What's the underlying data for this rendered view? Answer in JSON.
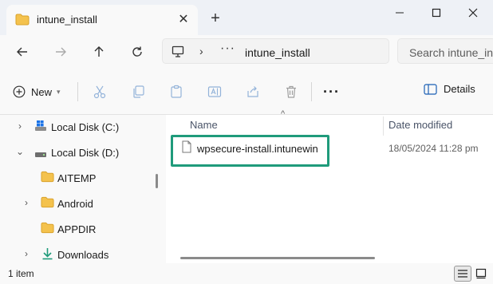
{
  "window": {
    "tab_title": "intune_install",
    "new_tab_glyph": "+",
    "close_tab_glyph": "✕"
  },
  "address": {
    "breadcrumb_overflow": "···",
    "path": "intune_install",
    "search_placeholder": "Search intune_install"
  },
  "toolbar": {
    "new_label": "New",
    "more_glyph": "···",
    "details_label": "Details"
  },
  "nav": {
    "items": [
      {
        "label": "Local Disk (C:)",
        "icon": "drive-windows-icon",
        "expand": "›"
      },
      {
        "label": "Local Disk (D:)",
        "icon": "drive-icon",
        "expand": "⌄"
      },
      {
        "label": "AITEMP",
        "icon": "folder-icon",
        "expand": ""
      },
      {
        "label": "Android",
        "icon": "folder-icon",
        "expand": "›"
      },
      {
        "label": "APPDIR",
        "icon": "folder-icon",
        "expand": ""
      },
      {
        "label": "Downloads",
        "icon": "download-icon",
        "expand": "›"
      }
    ]
  },
  "content": {
    "sort_indicator": "^",
    "columns": {
      "name": "Name",
      "date": "Date modified"
    },
    "files": [
      {
        "name": "wpsecure-install.intunewin",
        "date": "18/05/2024 11:28 pm",
        "icon": "file-icon"
      }
    ]
  },
  "status": {
    "item_count": "1 item"
  },
  "colors": {
    "highlight": "#1f9b7b",
    "folder": "#f4c24d",
    "accent": "#1a73e8"
  }
}
